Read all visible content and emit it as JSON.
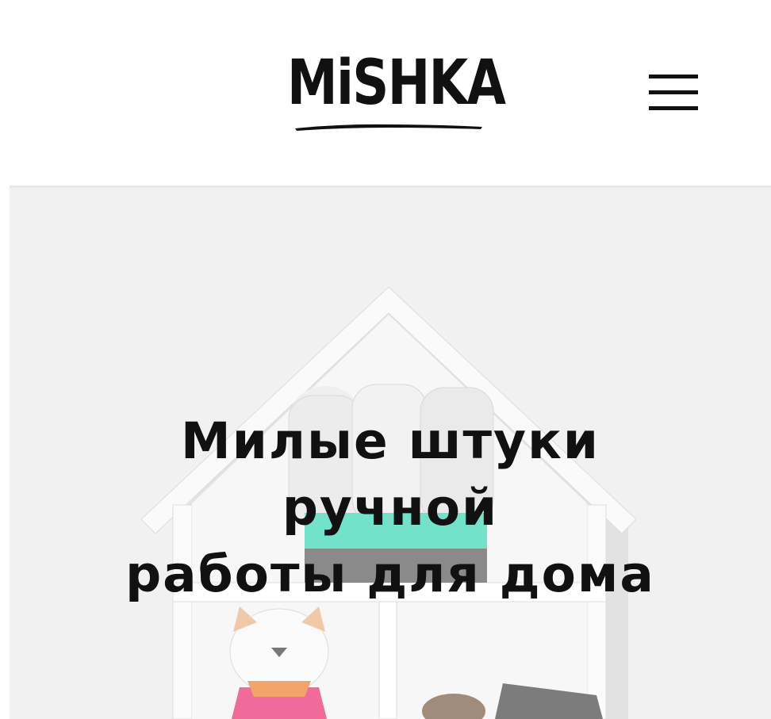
{
  "header": {
    "logo_text": "MiSHKA",
    "menu_icon": "hamburger-menu-icon"
  },
  "hero": {
    "title": "Милые штуки\nручной\nработы для дома",
    "image": "house-shelf-with-handmade-toys",
    "colors": {
      "background": "#f1f1f1",
      "shelf": "#ffffff",
      "basket_mint": "#72e2c8",
      "basket_gray": "#888888",
      "basket_pink": "#e4599d"
    }
  }
}
